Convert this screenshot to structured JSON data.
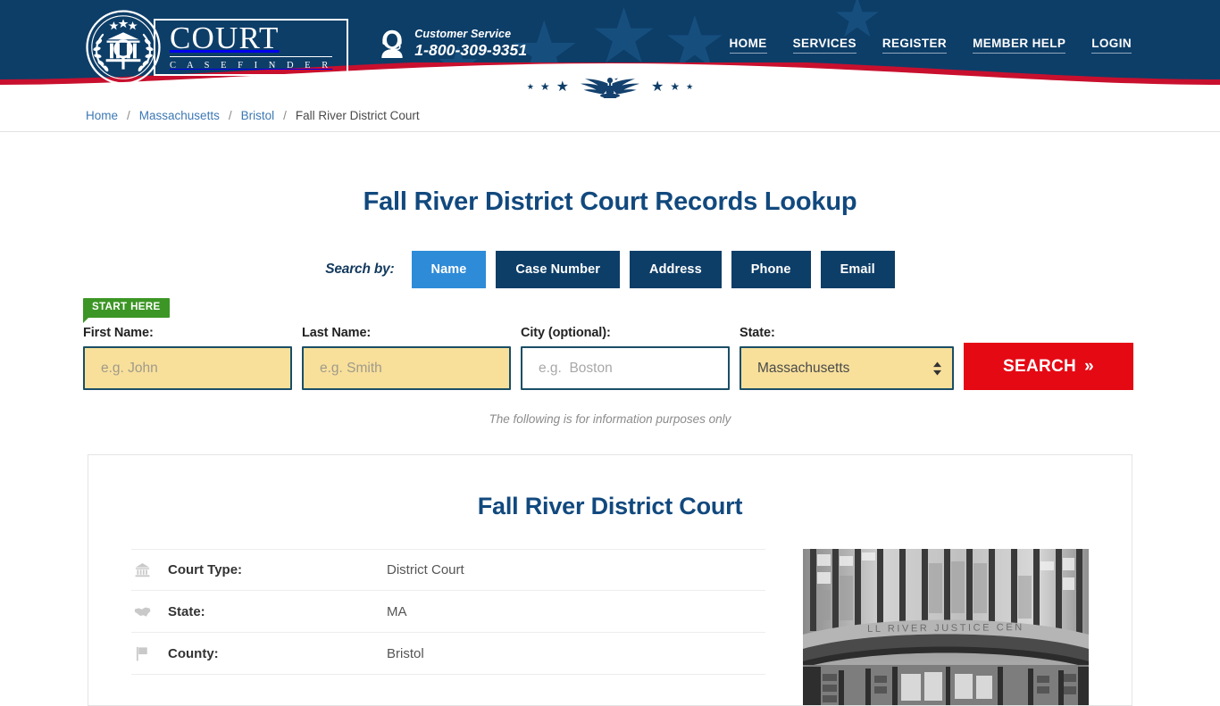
{
  "header": {
    "logo": {
      "emblem_icon": "court-seal-icon",
      "word": "COURT",
      "subword": "C A S E  F I N D E R"
    },
    "customer_service": {
      "icon": "headset-support-icon",
      "label": "Customer Service",
      "phone": "1-800-309-9351"
    },
    "nav": [
      {
        "label": "HOME"
      },
      {
        "label": "SERVICES"
      },
      {
        "label": "REGISTER"
      },
      {
        "label": "MEMBER HELP"
      },
      {
        "label": "LOGIN"
      }
    ],
    "ribbon": {
      "eagle_icon": "eagle-icon",
      "star_icon": "star-icon"
    },
    "colors": {
      "navy": "#0d3e68",
      "red": "#c8102e",
      "white": "#ffffff"
    }
  },
  "breadcrumb": {
    "items": [
      {
        "label": "Home",
        "current": false
      },
      {
        "label": "Massachusetts",
        "current": false
      },
      {
        "label": "Bristol",
        "current": false
      },
      {
        "label": "Fall River District Court",
        "current": true
      }
    ],
    "separator": "/"
  },
  "main": {
    "page_title": "Fall River District Court Records Lookup",
    "search_by": {
      "label": "Search by:",
      "tabs": [
        {
          "label": "Name",
          "active": true
        },
        {
          "label": "Case Number",
          "active": false
        },
        {
          "label": "Address",
          "active": false
        },
        {
          "label": "Phone",
          "active": false
        },
        {
          "label": "Email",
          "active": false
        }
      ],
      "active_color": "#2e8bd8",
      "inactive_color": "#0d3e68"
    },
    "start_badge": "START HERE",
    "form": {
      "first_name": {
        "label": "First Name:",
        "value": "",
        "placeholder": "e.g. John"
      },
      "last_name": {
        "label": "Last Name:",
        "value": "",
        "placeholder": "e.g. Smith"
      },
      "city": {
        "label": "City (optional):",
        "value": "",
        "placeholder": "e.g.  Boston"
      },
      "state": {
        "label": "State:",
        "value": "Massachusetts",
        "options": [
          "Massachusetts"
        ]
      },
      "search_button": {
        "label": "SEARCH",
        "chevron": "»",
        "color": "#e50914"
      }
    },
    "disclaimer": "The following is for information purposes only"
  },
  "card": {
    "title": "Fall River District Court",
    "rows": [
      {
        "icon": "bank-icon",
        "label": "Court Type:",
        "value": "District Court"
      },
      {
        "icon": "us-map-icon",
        "label": "State:",
        "value": "MA"
      },
      {
        "icon": "flag-icon",
        "label": "County:",
        "value": "Bristol"
      }
    ],
    "photo": {
      "name": "court-building-photo",
      "caption_on_building": "FALL RIVER JUSTICE CENTER"
    }
  }
}
